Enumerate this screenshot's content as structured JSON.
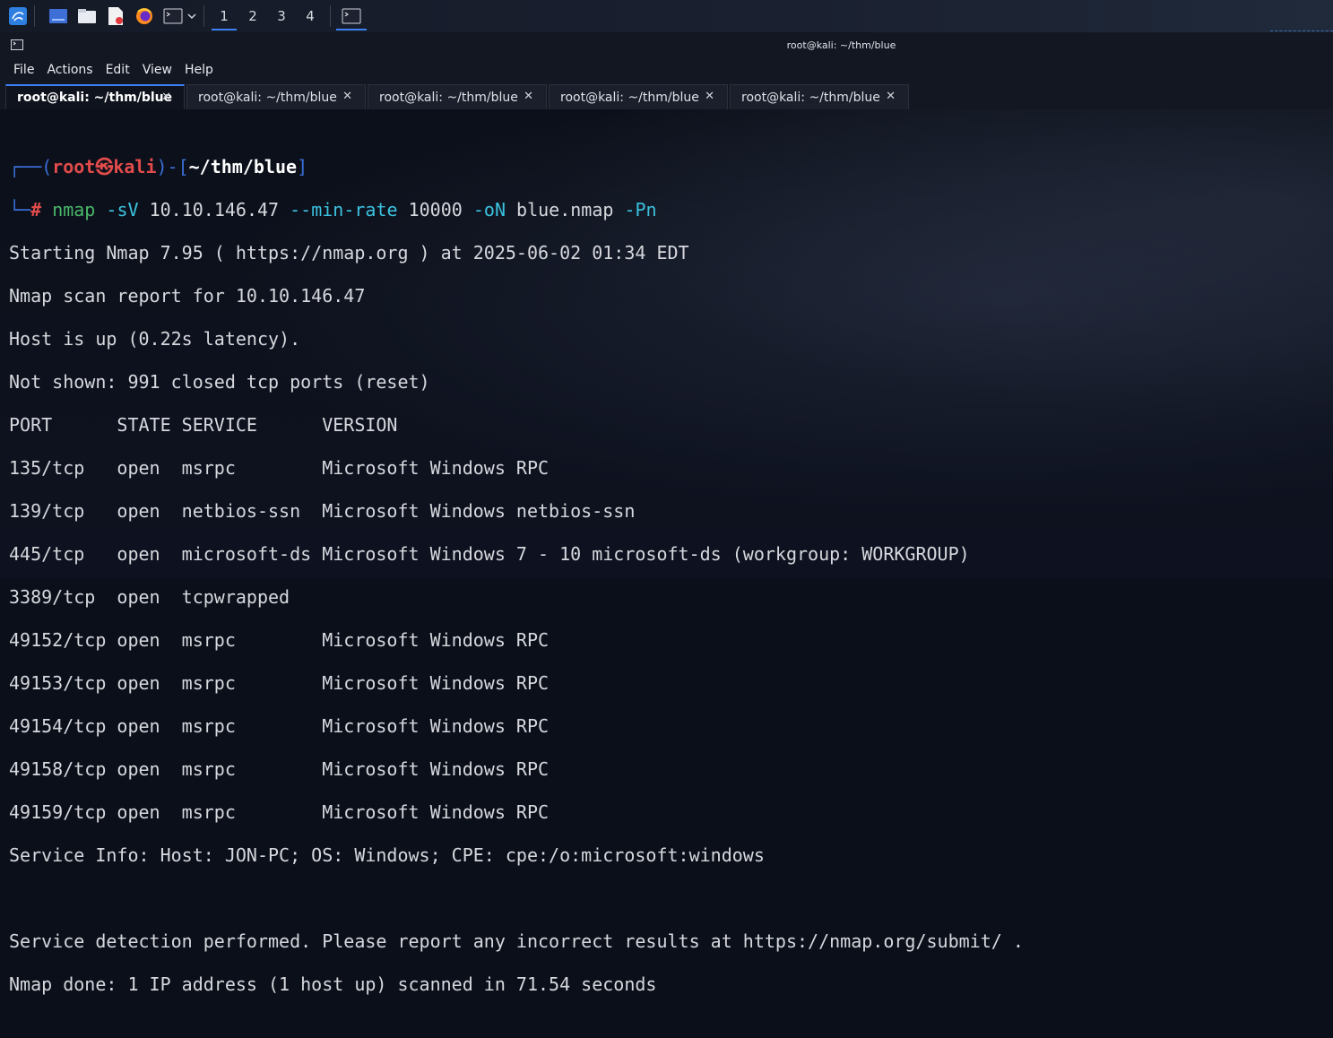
{
  "taskbar": {
    "workspaces": [
      "1",
      "2",
      "3",
      "4"
    ],
    "icons": [
      "kali-menu-icon",
      "show-desktop-icon",
      "file-manager-icon",
      "text-editor-icon",
      "firefox-icon",
      "terminal-icon"
    ]
  },
  "window": {
    "title": "root@kali: ~/thm/blue"
  },
  "menu": [
    "File",
    "Actions",
    "Edit",
    "View",
    "Help"
  ],
  "tabs": [
    {
      "label": "root@kali: ~/thm/blue",
      "active": true
    },
    {
      "label": "root@kali: ~/thm/blue",
      "active": false
    },
    {
      "label": "root@kali: ~/thm/blue",
      "active": false
    },
    {
      "label": "root@kali: ~/thm/blue",
      "active": false
    },
    {
      "label": "root@kali: ~/thm/blue",
      "active": false
    }
  ],
  "prompt": {
    "user": "root",
    "host": "kali",
    "path": "~/thm/blue",
    "symbol": "#",
    "cmd": "nmap",
    "arg1": "-sV",
    "target": "10.10.146.47",
    "arg2": "--min-rate",
    "rate": "10000",
    "arg3": "-oN",
    "outfile": "blue.nmap",
    "arg4": "-Pn"
  },
  "output": [
    "Starting Nmap 7.95 ( https://nmap.org ) at 2025-06-02 01:34 EDT",
    "Nmap scan report for 10.10.146.47",
    "Host is up (0.22s latency).",
    "Not shown: 991 closed tcp ports (reset)",
    "PORT      STATE SERVICE      VERSION",
    "135/tcp   open  msrpc        Microsoft Windows RPC",
    "139/tcp   open  netbios-ssn  Microsoft Windows netbios-ssn",
    "445/tcp   open  microsoft-ds Microsoft Windows 7 - 10 microsoft-ds (workgroup: WORKGROUP)",
    "3389/tcp  open  tcpwrapped",
    "49152/tcp open  msrpc        Microsoft Windows RPC",
    "49153/tcp open  msrpc        Microsoft Windows RPC",
    "49154/tcp open  msrpc        Microsoft Windows RPC",
    "49158/tcp open  msrpc        Microsoft Windows RPC",
    "49159/tcp open  msrpc        Microsoft Windows RPC",
    "Service Info: Host: JON-PC; OS: Windows; CPE: cpe:/o:microsoft:windows",
    "",
    "Service detection performed. Please report any incorrect results at https://nmap.org/submit/ .",
    "Nmap done: 1 IP address (1 host up) scanned in 71.54 seconds"
  ]
}
